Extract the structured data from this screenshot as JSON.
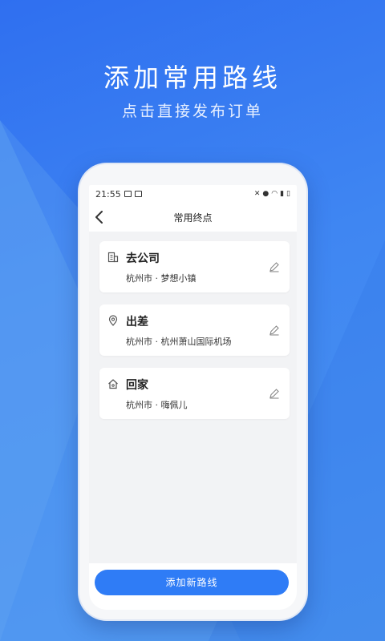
{
  "promo": {
    "title": "添加常用路线",
    "subtitle": "点击直接发布订单"
  },
  "status_bar": {
    "time": "21:55",
    "icons": [
      "image-icon",
      "notification-icon",
      "mute-icon",
      "location-icon",
      "wifi-icon",
      "signal-icon",
      "battery-icon"
    ]
  },
  "nav": {
    "back_icon": "chevron-left-icon",
    "title": "常用终点"
  },
  "routes": [
    {
      "name": "去公司",
      "address": "杭州市 · 梦想小镇",
      "icon": "building-icon"
    },
    {
      "name": "出差",
      "address": "杭州市 · 杭州萧山国际机场",
      "icon": "location-pin-icon"
    },
    {
      "name": "回家",
      "address": "杭州市 · 嗨佩儿",
      "icon": "home-icon"
    }
  ],
  "add_button": {
    "label": "添加新路线"
  },
  "colors": {
    "accent": "#2f7cf6",
    "background": "#3f86f2"
  }
}
